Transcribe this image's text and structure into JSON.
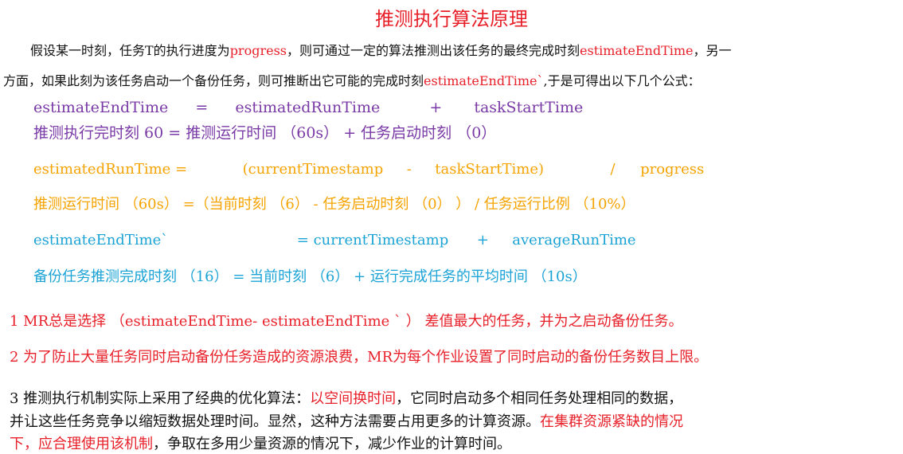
{
  "title": "推测执行算法原理",
  "intro": {
    "l1_a": "假设某一时刻，任务T的执行进度为",
    "l1_b": "progress",
    "l1_c": "，则可通过一定的算法推测出该任务的最终完成时刻",
    "l1_d": "estimateEndTime",
    "l1_e": "，另一",
    "l2_a": "方面，如果此刻为该任务启动一个备份任务，则可推断出它可能的完成时刻",
    "l2_b": "estimateEndTime`",
    "l2_c": ",于是可得出以下几个公式："
  },
  "formula1": {
    "a": "estimateEndTime",
    "b": "=",
    "c": "estimatedRunTime",
    "d": "+",
    "e": "taskStartTime",
    "cn": "推测执行完时刻 60 =  推测运行时间 （60s） +   任务启动时刻 （0）"
  },
  "formula2": {
    "a": "estimatedRunTime =",
    "b": "(currentTimestamp",
    "c": "-",
    "d": "taskStartTime)",
    "e": "/",
    "f": "progress",
    "cn": "推测运行时间 （60s）  =（当前时刻 （6）    -   任务启动时刻 （0） ）  /    任务运行比例 （10%）"
  },
  "formula3": {
    "a": "estimateEndTime`",
    "b": "= currentTimestamp",
    "c": "+",
    "d": "averageRunTime",
    "cn": "备份任务推测完成时刻 （16）    =  当前时刻 （6）     +  运行完成任务的平均时间 （10s）"
  },
  "point1": "1 MR总是选择 （estimateEndTime-  estimateEndTime ` ） 差值最大的任务，并为之启动备份任务。",
  "point2": "2 为了防止大量任务同时启动备份任务造成的资源浪费，MR为每个作业设置了同时启动的备份任务数目上限。",
  "point3": {
    "a": "3 推测执行机制实际上采用了经典的优化算法：",
    "b": "以空间换时间",
    "c": "，它同时启动多个相同任务处理相同的数据，",
    "d": "并让这些任务竞争以缩短数据处理时间。显然，这种方法需要占用更多的计算资源。",
    "e": "在集群资源紧缺的情况",
    "f": "下，应合理使用该机制",
    "g": "，争取在多用少量资源的情况下，减少作业的计算时间。"
  },
  "colors": {
    "red": "#e8202a",
    "purple": "#7a3aa6",
    "orange": "#f5a300",
    "cyan": "#1ba3d6"
  }
}
